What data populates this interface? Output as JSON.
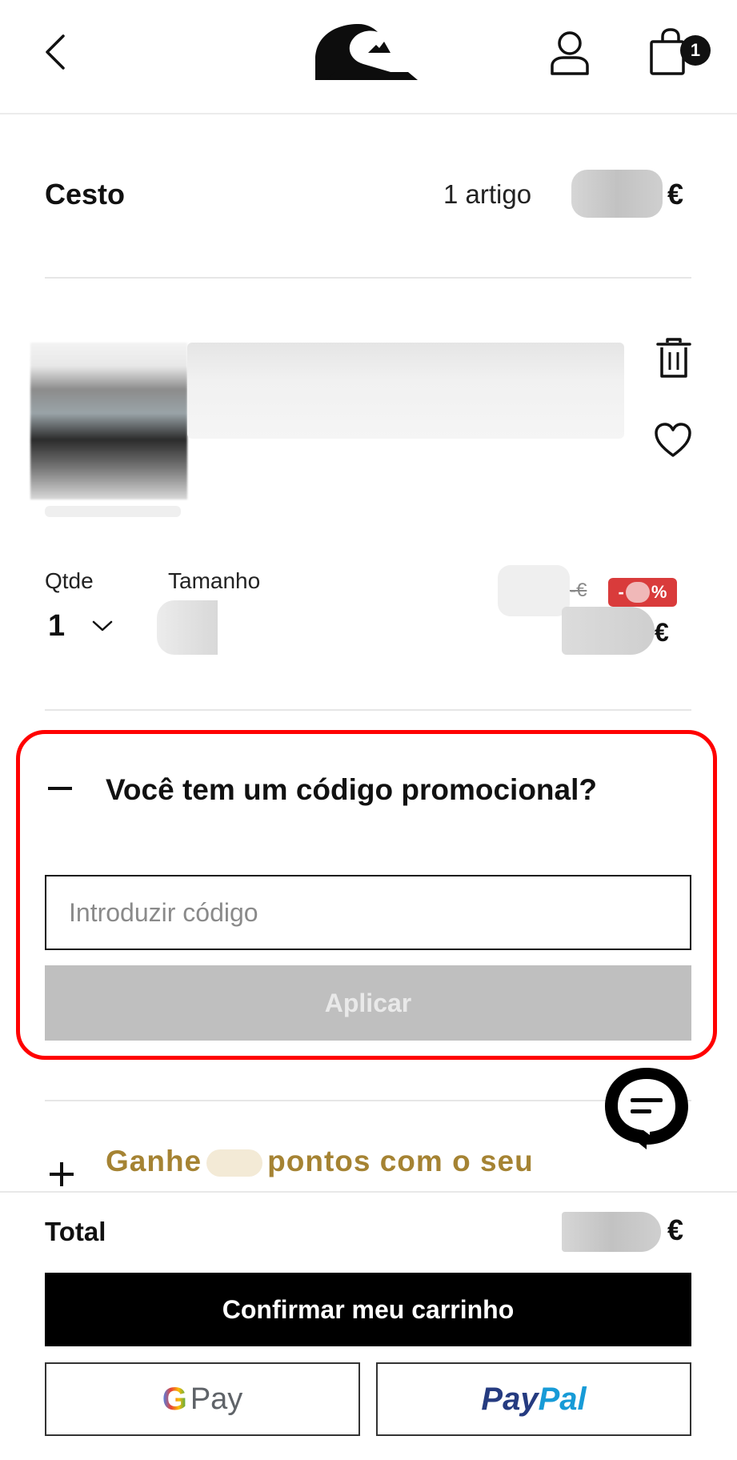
{
  "header": {
    "brand": "Quiksilver",
    "cart_count": "1"
  },
  "cart": {
    "title": "Cesto",
    "item_count_text": "1 artigo",
    "currency": "€"
  },
  "product": {
    "qty_label": "Qtde",
    "qty_value": "1",
    "size_label": "Tamanho",
    "discount_prefix": "-",
    "discount_suffix": "%",
    "old_price_currency": "-€",
    "new_price_currency": "€"
  },
  "promo": {
    "title": "Você tem um código promocional?",
    "input_placeholder": "Introduzir código",
    "apply_label": "Aplicar"
  },
  "loyalty": {
    "text_before": "Ganhe",
    "text_after": "pontos com o seu"
  },
  "bottom": {
    "total_label": "Total",
    "currency": "€",
    "confirm_label": "Confirmar meu carrinho",
    "gpay_g": "G",
    "gpay_pay": "Pay",
    "paypal_pay": "Pay",
    "paypal_pal": "Pal"
  },
  "colors": {
    "promo_highlight": "#ff0000",
    "discount_badge": "#d93b3b",
    "loyalty_text": "#a58333",
    "apply_disabled": "#bfbfbf",
    "confirm_bg": "#000000"
  }
}
